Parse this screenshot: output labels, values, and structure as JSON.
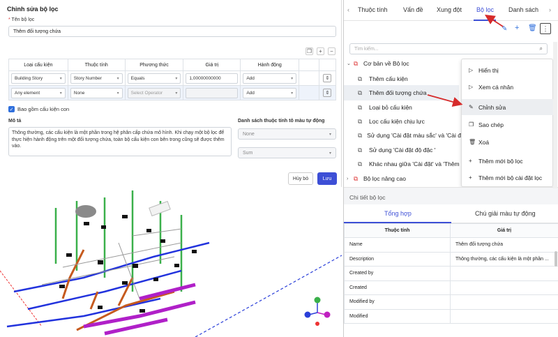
{
  "dialog": {
    "title": "Chỉnh sửa bộ lọc",
    "name_label": "Tên bộ lọc",
    "name_value": "Thêm đối tượng chứa",
    "columns": [
      "Loại cấu kiện",
      "Thuộc tính",
      "Phương thức",
      "Giá trị",
      "Hành động"
    ],
    "rows": [
      [
        "Building Story",
        "Story Number",
        "Equals",
        "1,00000000000",
        "Add"
      ],
      [
        "Any element",
        "None",
        "Select Operator",
        "",
        "Add"
      ]
    ],
    "include_children_label": "Bao gồm cấu kiện con",
    "description_label": "Mô tả",
    "description": "Thông thường, các cấu kiện là một phần trong hệ phân cấp chứa mô hình. Khi chạy một bộ lọc để thực hiện hành động trên một đối tượng chứa, toàn bộ cấu kiện con bên trong cũng sẽ được thêm vào.",
    "auto_color_label": "Danh sách thuộc tính tô màu tự động",
    "auto_color_value1": "None",
    "auto_color_value2": "Sum",
    "cancel_label": "Hủy bỏ",
    "save_label": "Lưu"
  },
  "right_panel": {
    "tabs": [
      "Thuộc tính",
      "Vấn đề",
      "Xung đột",
      "Bộ lọc",
      "Danh sách"
    ],
    "active_tab": "Bộ lọc",
    "search_placeholder": "Tìm kiếm...",
    "tree": [
      {
        "label": "Cơ bản về Bộ lọc",
        "level": 0
      },
      {
        "label": "Thêm cấu kiện",
        "level": 1
      },
      {
        "label": "Thêm đối tượng chứa",
        "level": 1
      },
      {
        "label": "Loại bỏ cấu kiện",
        "level": 1
      },
      {
        "label": "Lọc cấu kiện chịu lực",
        "level": 1
      },
      {
        "label": "Sử dụng 'Cài đặt màu sắc' và 'Cài đ",
        "level": 1
      },
      {
        "label": "Sử dụng 'Cài đặt độ đặc '",
        "level": 1
      },
      {
        "label": "Khác nhau giữa 'Cài đặt' và 'Thêm",
        "level": 1
      },
      {
        "label": "Bộ lọc nâng cao",
        "level": 0
      }
    ],
    "menu": [
      "Hiển thị",
      "Xem cá nhân",
      "Chỉnh sửa",
      "Sao chép",
      "Xoá",
      "Thêm mới bộ lọc",
      "Thêm mới bộ cài đặt lọc"
    ],
    "details_title": "Chi tiết bộ lọc",
    "details_tabs": [
      "Tổng hợp",
      "Chú giải màu tự động"
    ],
    "details_columns": [
      "Thuộc tính",
      "Giá trị"
    ],
    "details_rows": [
      [
        "Name",
        "Thêm đối tượng chứa"
      ],
      [
        "Description",
        "Thông thường, các cấu kiện là một phần ..."
      ],
      [
        "Created by",
        ""
      ],
      [
        "Created",
        ""
      ],
      [
        "Modified by",
        ""
      ],
      [
        "Modified",
        ""
      ]
    ]
  },
  "colors": {
    "accent": "#3d4fd6",
    "arrow": "#d62b2b"
  }
}
